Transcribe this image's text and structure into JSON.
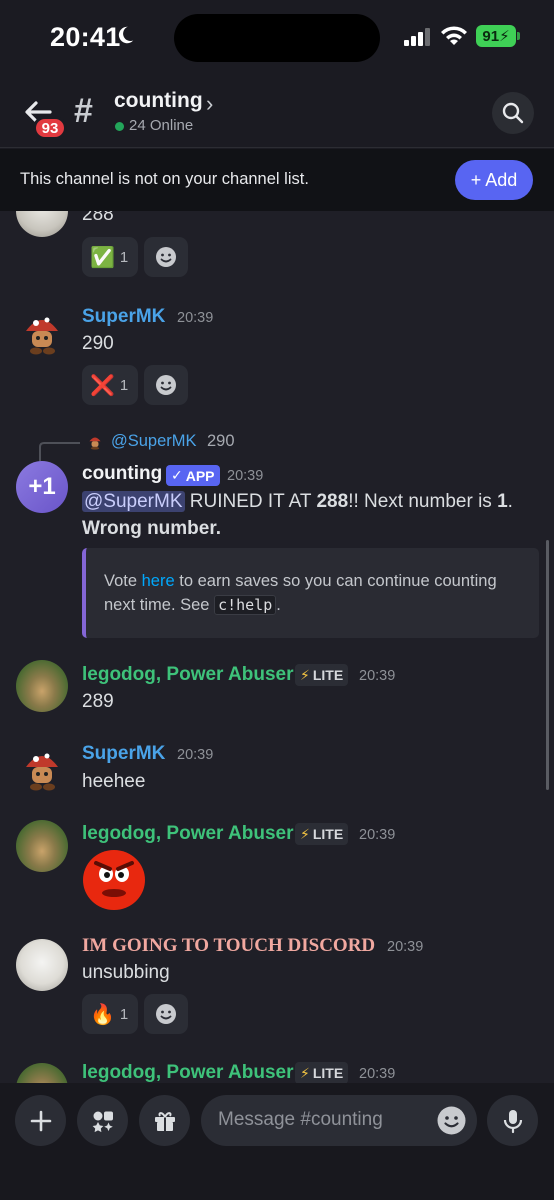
{
  "status_bar": {
    "time": "20:41",
    "battery": "91"
  },
  "header": {
    "back_badge": "93",
    "channel_name": "counting",
    "online": "24 Online"
  },
  "notice": {
    "text": "This channel is not on your channel list.",
    "add_label": "+ Add"
  },
  "messages": [
    {
      "user": "",
      "text": "288",
      "reaction": {
        "emoji": "✅",
        "count": "1"
      }
    },
    {
      "user": "SuperMK",
      "time": "20:39",
      "text": "290",
      "reaction": {
        "emoji": "❌",
        "count": "1"
      }
    },
    {
      "reply": {
        "user": "@SuperMK",
        "text": "290"
      },
      "avatar_text": "+1",
      "user": "counting",
      "tag": "APP",
      "time": "20:39",
      "text_mention": "@SuperMK",
      "text_a": " RUINED IT AT ",
      "text_b": "288",
      "text_c": "!! Next number is ",
      "text_d": "1",
      "text_e": ".",
      "text_line2": "Wrong number.",
      "embed": {
        "pre": "Vote ",
        "link": "here",
        "mid": " to earn saves so you can continue counting next time. See ",
        "code": "c!help",
        "post": "."
      }
    },
    {
      "user": "legodog, Power Abuser",
      "tag": "LITE",
      "time": "20:39",
      "text": "289"
    },
    {
      "user": "SuperMK",
      "time": "20:39",
      "text": "heehee"
    },
    {
      "user": "legodog, Power Abuser",
      "tag": "LITE",
      "time": "20:39"
    },
    {
      "user": "IM GOING TO TOUCH DISCORD",
      "time": "20:39",
      "text": "unsubbing",
      "reaction": {
        "emoji": "🔥",
        "count": "1"
      }
    },
    {
      "user": "legodog, Power Abuser",
      "tag": "LITE",
      "time": "20:39"
    }
  ],
  "composer": {
    "placeholder": "Message #counting"
  },
  "colors": {
    "supermk": "#4aa3e8",
    "legodog": "#3ec27a",
    "touch": "#f0a8a0",
    "counting": "#f2f3f5",
    "accent": "#5865f2"
  }
}
